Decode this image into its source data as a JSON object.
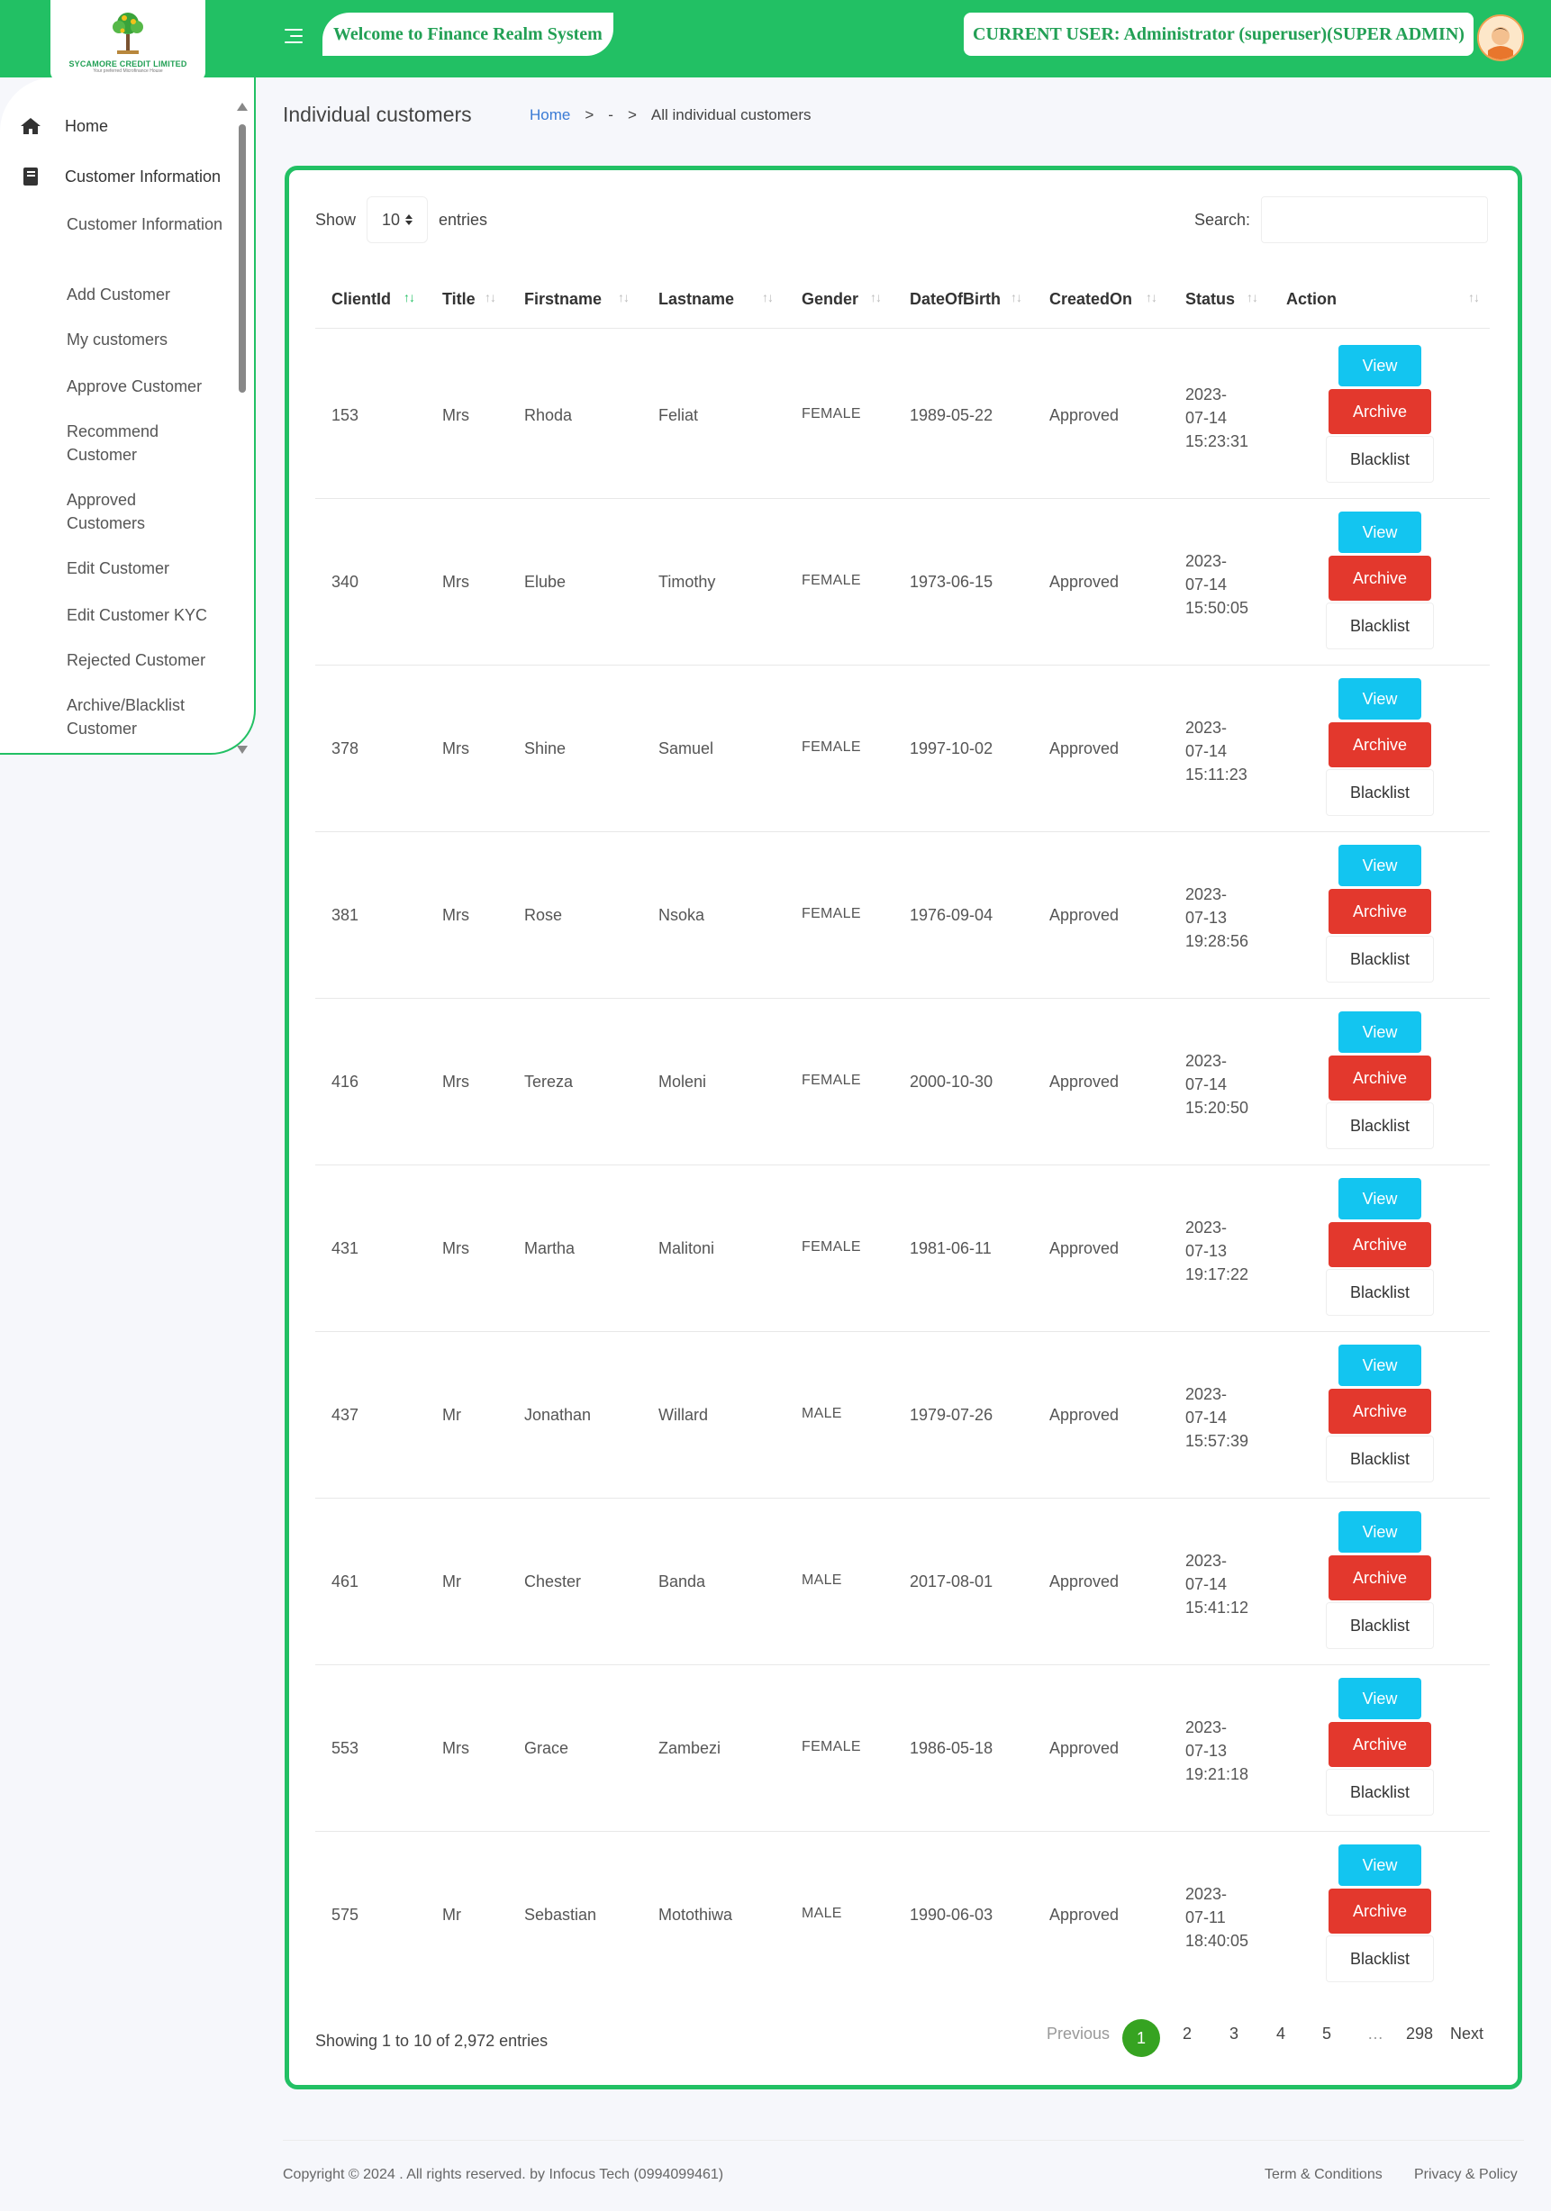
{
  "header": {
    "logo_name": "SYCAMORE CREDIT LIMITED",
    "logo_tagline": "Your preferred Microfinance House",
    "welcome": "Welcome to Finance Realm System",
    "current_user": "CURRENT USER: Administrator (superuser)(SUPER ADMIN)"
  },
  "sidebar": {
    "home": "Home",
    "section": "Customer Information",
    "items": [
      "Customer Information",
      "Add Customer",
      "My customers",
      "Approve Customer",
      "Recommend Customer",
      "Approved Customers",
      "Edit Customer",
      "Edit Customer KYC",
      "Rejected Customer",
      "Archive/Blacklist Customer"
    ]
  },
  "page": {
    "title": "Individual customers",
    "breadcrumb": [
      "Home",
      ">",
      "-",
      ">",
      "All individual customers"
    ]
  },
  "table_controls": {
    "show_label": "Show",
    "page_size": "10",
    "entries_label": "entries",
    "search_label": "Search:"
  },
  "table": {
    "columns": [
      "ClientId",
      "Title",
      "Firstname",
      "Lastname",
      "Gender",
      "DateOfBirth",
      "CreatedOn",
      "Status",
      "Action"
    ],
    "rows": [
      {
        "id": "153",
        "title": "Mrs",
        "first": "Rhoda",
        "last": "Feliat",
        "gender": "FEMALE",
        "dob": "1989-05-22",
        "created": "Approved",
        "status": [
          "2023-",
          "07-14",
          "15:23:31"
        ]
      },
      {
        "id": "340",
        "title": "Mrs",
        "first": "Elube",
        "last": "Timothy",
        "gender": "FEMALE",
        "dob": "1973-06-15",
        "created": "Approved",
        "status": [
          "2023-",
          "07-14",
          "15:50:05"
        ]
      },
      {
        "id": "378",
        "title": "Mrs",
        "first": "Shine",
        "last": "Samuel",
        "gender": "FEMALE",
        "dob": "1997-10-02",
        "created": "Approved",
        "status": [
          "2023-",
          "07-14",
          "15:11:23"
        ]
      },
      {
        "id": "381",
        "title": "Mrs",
        "first": "Rose",
        "last": "Nsoka",
        "gender": "FEMALE",
        "dob": "1976-09-04",
        "created": "Approved",
        "status": [
          "2023-",
          "07-13",
          "19:28:56"
        ]
      },
      {
        "id": "416",
        "title": "Mrs",
        "first": "Tereza",
        "last": "Moleni",
        "gender": "FEMALE",
        "dob": "2000-10-30",
        "created": "Approved",
        "status": [
          "2023-",
          "07-14",
          "15:20:50"
        ]
      },
      {
        "id": "431",
        "title": "Mrs",
        "first": "Martha",
        "last": "Malitoni",
        "gender": "FEMALE",
        "dob": "1981-06-11",
        "created": "Approved",
        "status": [
          "2023-",
          "07-13",
          "19:17:22"
        ]
      },
      {
        "id": "437",
        "title": "Mr",
        "first": "Jonathan",
        "last": "Willard",
        "gender": "MALE",
        "dob": "1979-07-26",
        "created": "Approved",
        "status": [
          "2023-",
          "07-14",
          "15:57:39"
        ]
      },
      {
        "id": "461",
        "title": "Mr",
        "first": "Chester",
        "last": "Banda",
        "gender": "MALE",
        "dob": "2017-08-01",
        "created": "Approved",
        "status": [
          "2023-",
          "07-14",
          "15:41:12"
        ]
      },
      {
        "id": "553",
        "title": "Mrs",
        "first": "Grace",
        "last": "Zambezi",
        "gender": "FEMALE",
        "dob": "1986-05-18",
        "created": "Approved",
        "status": [
          "2023-",
          "07-13",
          "19:21:18"
        ]
      },
      {
        "id": "575",
        "title": "Mr",
        "first": "Sebastian",
        "last": "Motothiwa",
        "gender": "MALE",
        "dob": "1990-06-03",
        "created": "Approved",
        "status": [
          "2023-",
          "07-11",
          "18:40:05"
        ]
      }
    ],
    "actions": {
      "view": "View",
      "archive": "Archive",
      "blacklist": "Blacklist"
    }
  },
  "pagination": {
    "info": "Showing 1 to 10 of 2,972 entries",
    "previous": "Previous",
    "pages": [
      "1",
      "2",
      "3",
      "4",
      "5",
      "…",
      "298"
    ],
    "next": "Next"
  },
  "footer": {
    "copyright": "Copyright © 2024 . All rights reserved. by Infocus Tech (0994099461)",
    "terms": "Term & Conditions",
    "privacy": "Privacy & Policy"
  },
  "colors": {
    "brand_green": "#22c064",
    "view": "#13c5f0",
    "archive": "#e3382d",
    "active_page": "#36a321"
  }
}
